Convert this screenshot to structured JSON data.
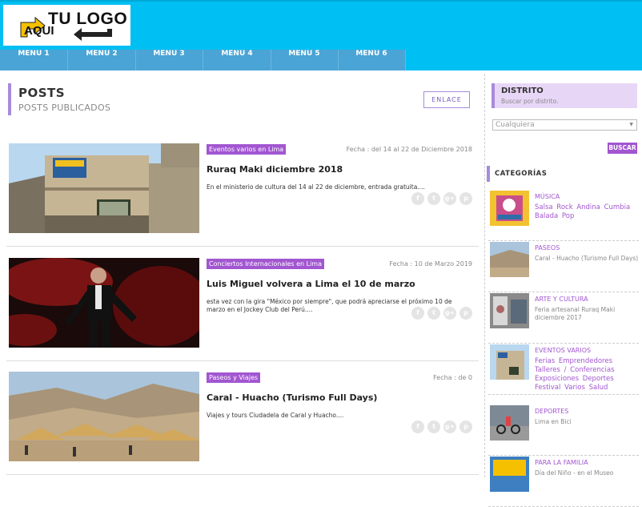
{
  "colors": {
    "header_bg": "#00bff3",
    "nav_bg": "#4aa4d5",
    "accent": "#a256d1",
    "accent_light": "#e8d6f7"
  },
  "logo": {
    "line1": "TU LOGO",
    "line2": "AQUI"
  },
  "nav": {
    "items": [
      "MENU 1",
      "MENU 2",
      "MENU 3",
      "MENU 4",
      "MENU 5",
      "MENU 6"
    ]
  },
  "posts_section": {
    "title": "POSTS",
    "subtitle": "POSTS PUBLICADOS",
    "link_label": "ENLACE"
  },
  "posts": [
    {
      "category": "Eventos varios en Lima",
      "date": "Fecha : del 14 al 22 de Diciembre 2018",
      "title": "Ruraq Maki diciembre 2018",
      "description": "En el ministerio de cultura del 14 al 22 de diciembre, entrada gratuita...."
    },
    {
      "category": "Conciertos Internacionales en Lima",
      "date": "Fecha : 10 de Marzo 2019",
      "title": "Luis Miguel volvera a Lima el 10 de marzo",
      "description": "esta vez con la gira \"México por siempre\", que podrá apreciarse el próximo 10 de marzo en el Jockey Club del Perú...."
    },
    {
      "category": "Paseos y Viajes",
      "date": "Fecha : de 0",
      "title": "Caral - Huacho (Turismo Full Days)",
      "description": "Viajes y tours Ciudadela de Caral y Huacho...."
    }
  ],
  "share_icons": [
    "facebook-icon",
    "twitter-icon",
    "google-plus-icon",
    "pinterest-icon"
  ],
  "share_glyphs": [
    "f",
    "t",
    "g+",
    "p"
  ],
  "sidebar": {
    "distrito_title": "DISTRITO",
    "distrito_sub": "Buscar por distrito.",
    "select_value": "Cualquiera",
    "search_button": "BUSCAR",
    "categories_title": "CATEGORÍAS",
    "categories": [
      {
        "name": "MÚSICA",
        "desc": "Salsa Rock Andina Cumbia Balada Pop"
      },
      {
        "name": "PASEOS",
        "desc": "Caral - Huacho (Turismo Full Days)"
      },
      {
        "name": "ARTE Y CULTURA",
        "desc": "Feria artesanal Ruraq Maki diciembre 2017"
      },
      {
        "name": "EVENTOS VARIOS",
        "desc": "Ferias Emprendedores Talleres / Conferencias Exposiciones Deportes Festival Varios Salud"
      },
      {
        "name": "DEPORTES",
        "desc": "Lima en Bici"
      },
      {
        "name": "PARA LA FAMILIA",
        "desc": "Día del Niño - en el Museo"
      }
    ]
  }
}
